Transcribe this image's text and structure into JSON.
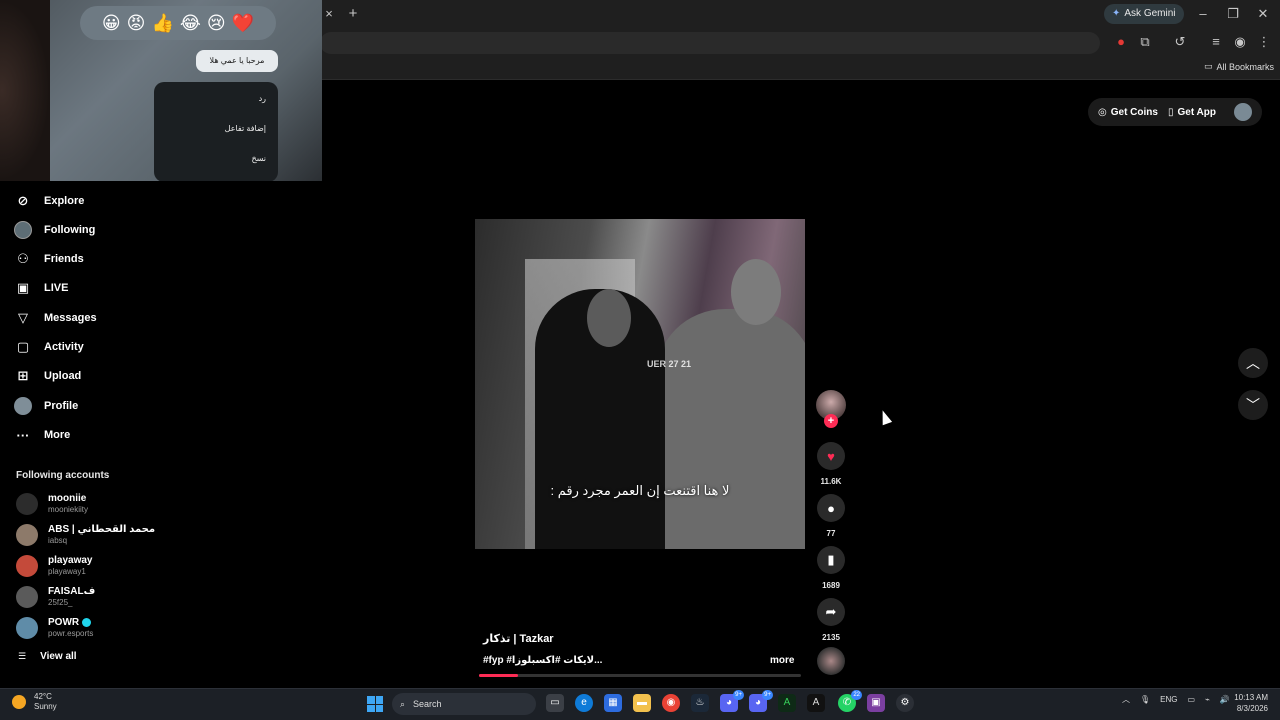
{
  "browser": {
    "ask_gemini": "Ask Gemini",
    "all_bookmarks": "All Bookmarks",
    "new_tab_symbol": "+",
    "close_tab_symbol": "×"
  },
  "webcam": {
    "emojis": [
      "😀",
      "😡",
      "👍",
      "😂",
      "😢",
      "❤️"
    ],
    "bubble_text": "مرحبا يا عمي هلا",
    "menu_items": [
      "رد",
      "إضافة تفاعل",
      "نسخ"
    ]
  },
  "sidebar": {
    "items": [
      {
        "label": "Explore",
        "icon": "compass-icon"
      },
      {
        "label": "Following",
        "icon": "following-avatar-icon"
      },
      {
        "label": "Friends",
        "icon": "friends-icon"
      },
      {
        "label": "LIVE",
        "icon": "live-icon"
      },
      {
        "label": "Messages",
        "icon": "messages-icon"
      },
      {
        "label": "Activity",
        "icon": "activity-icon"
      },
      {
        "label": "Upload",
        "icon": "upload-icon"
      },
      {
        "label": "Profile",
        "icon": "profile-avatar-icon"
      },
      {
        "label": "More",
        "icon": "more-icon"
      }
    ],
    "following_title": "Following accounts",
    "accounts": [
      {
        "name": "mooniie",
        "handle": "mooniekiity"
      },
      {
        "name": "ABS | محمد القحطاني",
        "handle": "iabsq"
      },
      {
        "name": "playaway",
        "handle": "playaway1"
      },
      {
        "name": "FAISALف",
        "handle": "25f25_"
      },
      {
        "name": "POWR",
        "handle": "powr.esports"
      }
    ],
    "view_all": "View all"
  },
  "top_actions": {
    "get_coins": "Get Coins",
    "get_app": "Get App"
  },
  "video": {
    "sign_text": "UER 27 21",
    "caption": "لا هنا اقتنعت إن العمر مجرد رقم :",
    "title": "تذكار | Tazkar",
    "tags": "#fyp #لايكات #اكسبلوزا...",
    "more": "more",
    "progress": 0.12
  },
  "rail": {
    "likes": "11.6K",
    "comments": "77",
    "saves": "1689",
    "shares": "2135"
  },
  "taskbar": {
    "temp": "42°C",
    "condition": "Sunny",
    "search": "Search",
    "lang": "ENG",
    "time": "10:13 AM",
    "date": "8/3/2026",
    "badges": {
      "discord1": "9+",
      "discord2": "9+",
      "whatsapp": "22"
    }
  },
  "colors": {
    "accent": "#fe2c55",
    "background": "#000000",
    "chrome": "#1f1f1f"
  }
}
